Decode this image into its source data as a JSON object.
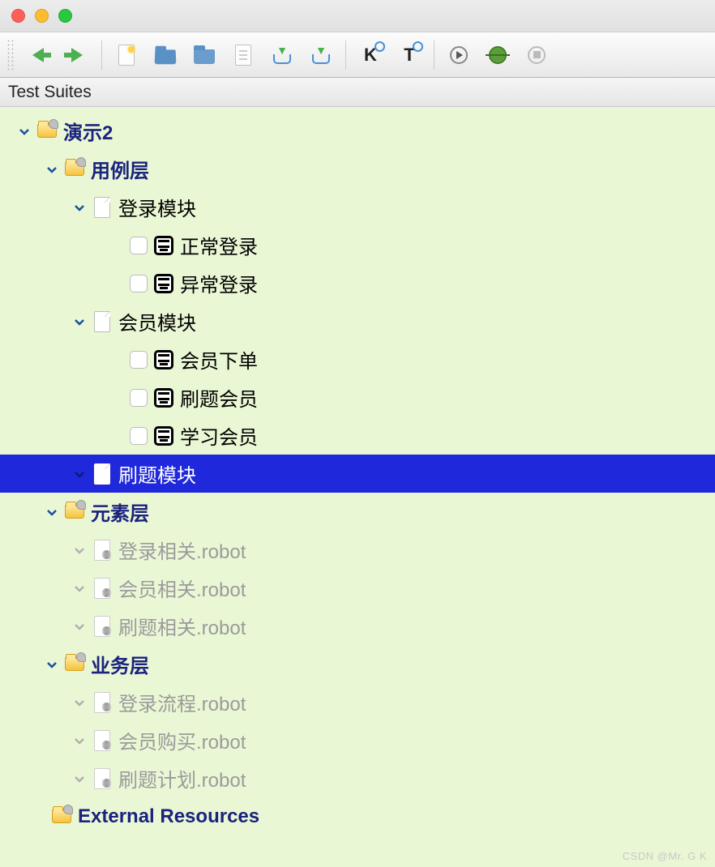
{
  "panel_title": "Test Suites",
  "watermark": "CSDN @Mr. G K",
  "toolbar": {
    "back": "Back",
    "forward": "Forward",
    "new_file": "New",
    "open_folder": "Open",
    "open_dir": "Open Directory",
    "edit_file": "Open File",
    "save": "Save",
    "save_all": "Save All",
    "search_kw": "Search Keywords",
    "search_test": "Search Tests",
    "run": "Run",
    "debug": "Debug",
    "stop": "Stop"
  },
  "tree": {
    "root": {
      "label": "演示2",
      "children": [
        {
          "label": "用例层",
          "icon": "folder",
          "children": [
            {
              "label": "登录模块",
              "icon": "file",
              "children": [
                {
                  "label": "正常登录",
                  "icon": "test"
                },
                {
                  "label": "异常登录",
                  "icon": "test"
                }
              ]
            },
            {
              "label": "会员模块",
              "icon": "file",
              "children": [
                {
                  "label": "会员下单",
                  "icon": "test"
                },
                {
                  "label": "刷题会员",
                  "icon": "test"
                },
                {
                  "label": "学习会员",
                  "icon": "test"
                }
              ]
            },
            {
              "label": "刷题模块",
              "icon": "file",
              "selected": true
            }
          ]
        },
        {
          "label": "元素层",
          "icon": "folder",
          "children": [
            {
              "label": "登录相关.robot",
              "icon": "resource",
              "dim": true
            },
            {
              "label": "会员相关.robot",
              "icon": "resource",
              "dim": true
            },
            {
              "label": "刷题相关.robot",
              "icon": "resource",
              "dim": true
            }
          ]
        },
        {
          "label": "业务层",
          "icon": "folder",
          "children": [
            {
              "label": "登录流程.robot",
              "icon": "resource",
              "dim": true
            },
            {
              "label": "会员购买.robot",
              "icon": "resource",
              "dim": true
            },
            {
              "label": "刷题计划.robot",
              "icon": "resource",
              "dim": true
            }
          ]
        }
      ]
    },
    "external": "External Resources"
  }
}
